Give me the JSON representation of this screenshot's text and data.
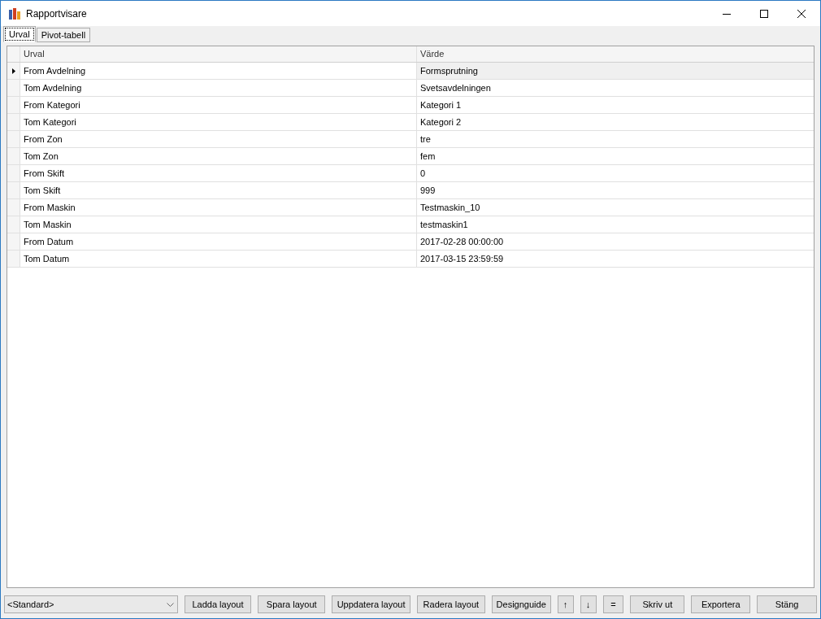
{
  "window": {
    "title": "Rapportvisare"
  },
  "tabs": [
    {
      "label": "Urval",
      "selected": true
    },
    {
      "label": "Pivot-tabell",
      "selected": false
    }
  ],
  "grid": {
    "columns": [
      "Urval",
      "Värde"
    ],
    "rows": [
      {
        "urval": "From Avdelning",
        "varde": "Formsprutning",
        "selected": true
      },
      {
        "urval": "Tom Avdelning",
        "varde": "Svetsavdelningen",
        "selected": false
      },
      {
        "urval": "From Kategori",
        "varde": "Kategori 1",
        "selected": false
      },
      {
        "urval": "Tom Kategori",
        "varde": "Kategori 2",
        "selected": false
      },
      {
        "urval": "From Zon",
        "varde": "tre",
        "selected": false
      },
      {
        "urval": "Tom Zon",
        "varde": "fem",
        "selected": false
      },
      {
        "urval": "From Skift",
        "varde": "0",
        "selected": false
      },
      {
        "urval": "Tom Skift",
        "varde": "999",
        "selected": false
      },
      {
        "urval": "From Maskin",
        "varde": "Testmaskin_10",
        "selected": false
      },
      {
        "urval": "Tom Maskin",
        "varde": "testmaskin1",
        "selected": false
      },
      {
        "urval": "From Datum",
        "varde": "2017-02-28 00:00:00",
        "selected": false
      },
      {
        "urval": "Tom Datum",
        "varde": "2017-03-15 23:59:59",
        "selected": false
      }
    ]
  },
  "layout_select": {
    "value": "<Standard>"
  },
  "buttons": [
    "Ladda layout",
    "Spara layout",
    "Uppdatera layout",
    "Radera layout",
    "Designguide",
    "↑",
    "↓",
    "=",
    "Skriv ut",
    "Exportera",
    "Stäng"
  ]
}
